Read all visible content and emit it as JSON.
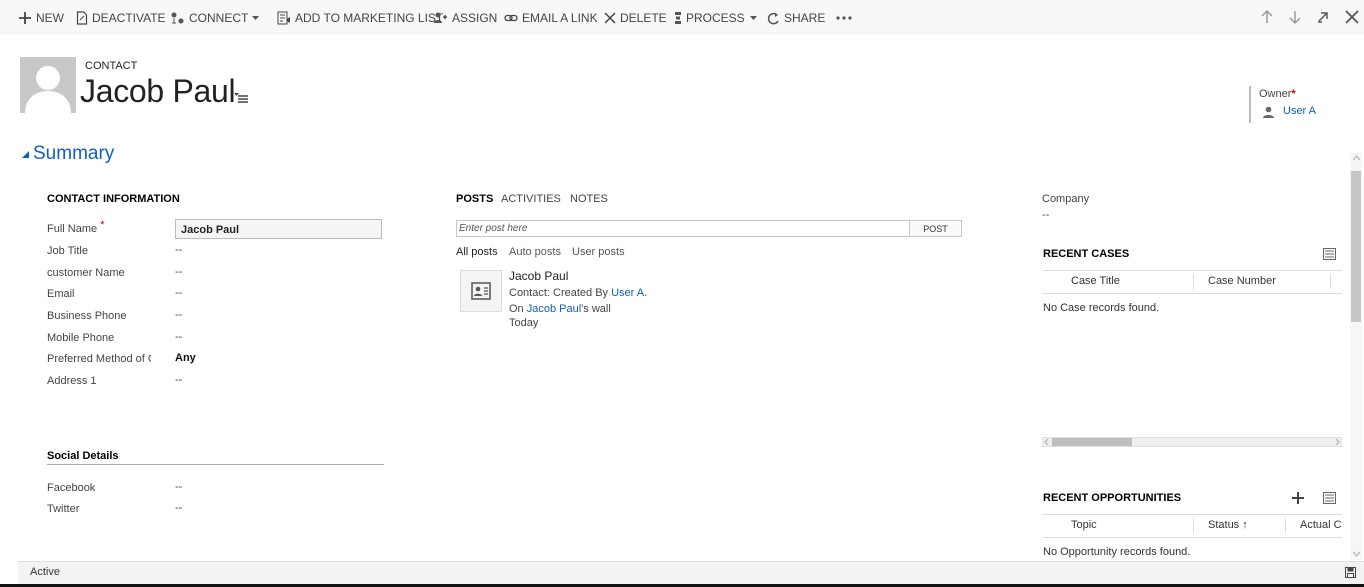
{
  "toolbar": {
    "new": "NEW",
    "deactivate": "DEACTIVATE",
    "connect": "CONNECT",
    "add_to_marketing_list": "ADD TO MARKETING LIST",
    "assign": "ASSIGN",
    "email_a_link": "EMAIL A LINK",
    "delete": "DELETE",
    "process": "PROCESS",
    "share": "SHARE"
  },
  "header": {
    "entity": "CONTACT",
    "record_name": "Jacob Paul",
    "owner_label": "Owner",
    "owner_required": "*",
    "owner_value": "User A"
  },
  "summary": {
    "title": "Summary"
  },
  "contact_info": {
    "heading": "CONTACT INFORMATION",
    "required_mark": "*",
    "fields": [
      {
        "label": "Full Name",
        "value": "Jacob Paul"
      },
      {
        "label": "Job Title",
        "value": "--"
      },
      {
        "label": "customer Name",
        "value": "--"
      },
      {
        "label": "Email",
        "value": "--"
      },
      {
        "label": "Business Phone",
        "value": "--"
      },
      {
        "label": "Mobile Phone",
        "value": "--"
      },
      {
        "label": "Preferred Method of C",
        "value": "Any"
      },
      {
        "label": "Address 1",
        "value": "--"
      }
    ]
  },
  "social": {
    "heading": "Social Details",
    "fields": [
      {
        "label": "Facebook",
        "value": "--"
      },
      {
        "label": "Twitter",
        "value": "--"
      }
    ]
  },
  "activity": {
    "tabs": [
      "POSTS",
      "ACTIVITIES",
      "NOTES"
    ],
    "post_placeholder": "Enter post here",
    "post_button": "POST",
    "filters": [
      "All posts",
      "Auto posts",
      "User posts"
    ],
    "post": {
      "author": "Jacob Paul",
      "line1_prefix": "Contact: Created By ",
      "line1_link": "User A.",
      "line2_prefix": "On ",
      "line2_link": "Jacob Paul",
      "line2_suffix": "'s wall",
      "time": "Today"
    }
  },
  "right": {
    "company_label": "Company",
    "company_value": "--",
    "cases": {
      "title": "RECENT CASES",
      "columns": [
        "Case Title",
        "Case Number"
      ],
      "empty": "No Case records found."
    },
    "opportunities": {
      "title": "RECENT OPPORTUNITIES",
      "columns": [
        "Topic",
        "Status ↑",
        "Actual Cl"
      ],
      "empty": "No Opportunity records found."
    }
  },
  "status_bar": {
    "status": "Active"
  }
}
